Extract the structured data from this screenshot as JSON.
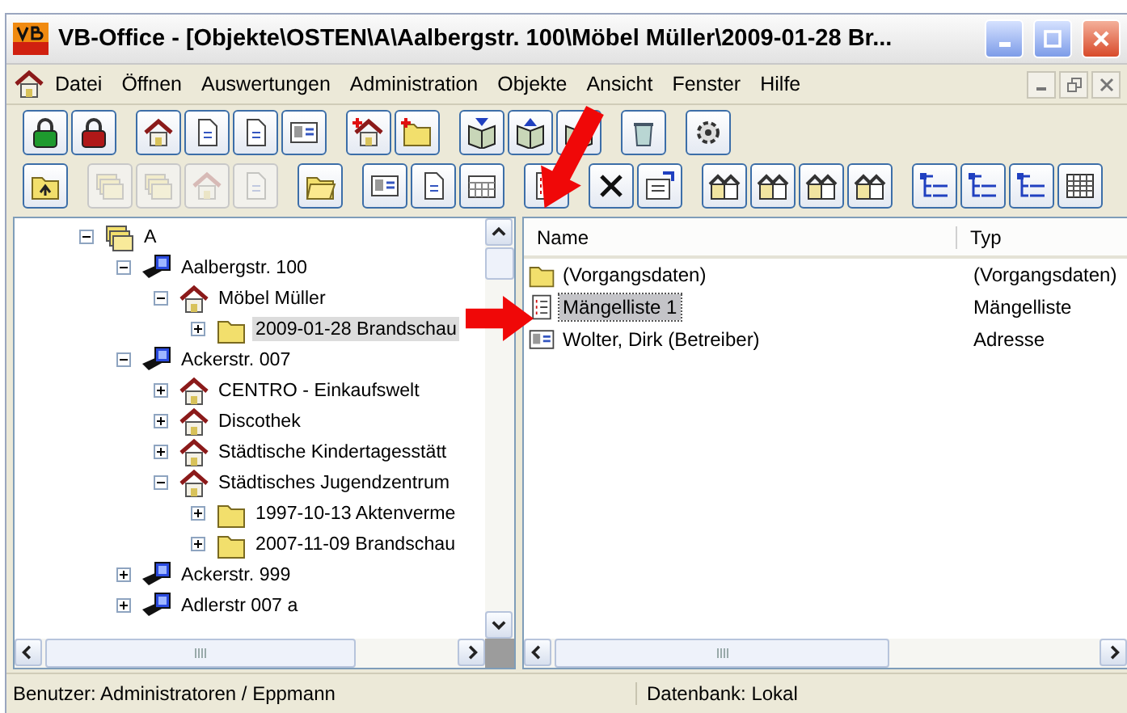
{
  "window": {
    "title": "VB-Office - [Objekte\\OSTEN\\A\\Aalbergstr. 100\\Möbel Müller\\2009-01-28 Br..."
  },
  "menu": [
    "Datei",
    "Öffnen",
    "Auswertungen",
    "Administration",
    "Objekte",
    "Ansicht",
    "Fenster",
    "Hilfe"
  ],
  "toolbars": [
    {
      "groups": [
        [
          {
            "kind": "lock-open",
            "disabled": false
          },
          {
            "kind": "lock-closed",
            "disabled": false
          }
        ],
        [
          {
            "kind": "house",
            "disabled": false
          },
          {
            "kind": "doc",
            "disabled": false
          },
          {
            "kind": "doc",
            "disabled": false
          },
          {
            "kind": "card",
            "disabled": false
          }
        ],
        [
          {
            "kind": "house-new",
            "disabled": false
          },
          {
            "kind": "folder-new",
            "disabled": false
          }
        ],
        [
          {
            "kind": "book-down",
            "disabled": false
          },
          {
            "kind": "book-up",
            "disabled": false
          },
          {
            "kind": "book",
            "disabled": false
          }
        ],
        [
          {
            "kind": "recycle",
            "disabled": false
          }
        ],
        [
          {
            "kind": "gear",
            "disabled": false
          }
        ]
      ]
    },
    {
      "groups": [
        [
          {
            "kind": "folder-up",
            "disabled": false
          }
        ],
        [
          {
            "kind": "stack",
            "disabled": true
          },
          {
            "kind": "stack",
            "disabled": true
          },
          {
            "kind": "house",
            "disabled": true
          },
          {
            "kind": "doc",
            "disabled": true
          }
        ],
        [
          {
            "kind": "folder-open",
            "disabled": false
          }
        ],
        [
          {
            "kind": "card",
            "disabled": false
          },
          {
            "kind": "doc",
            "disabled": false
          },
          {
            "kind": "calendar",
            "disabled": false
          }
        ],
        [
          {
            "kind": "list",
            "disabled": false
          }
        ],
        [
          {
            "kind": "delete",
            "disabled": false
          },
          {
            "kind": "properties",
            "disabled": false
          }
        ],
        [
          {
            "kind": "houses",
            "disabled": false
          },
          {
            "kind": "houses",
            "disabled": false
          },
          {
            "kind": "houses",
            "disabled": false
          },
          {
            "kind": "houses",
            "disabled": false
          }
        ],
        [
          {
            "kind": "tree",
            "disabled": false
          },
          {
            "kind": "tree",
            "disabled": false
          },
          {
            "kind": "tree",
            "disabled": false
          },
          {
            "kind": "grid",
            "disabled": false
          }
        ]
      ]
    }
  ],
  "tree": [
    {
      "label": "A",
      "kind": "group",
      "expanded": true,
      "selected": false,
      "children": [
        {
          "label": "Aalbergstr. 100",
          "kind": "street",
          "expanded": true,
          "selected": false,
          "children": [
            {
              "label": "Möbel Müller",
              "kind": "house",
              "expanded": true,
              "selected": false,
              "children": [
                {
                  "label": "2009-01-28 Brandschau",
                  "kind": "folder",
                  "expanded": false,
                  "selected": true
                }
              ]
            }
          ]
        },
        {
          "label": "Ackerstr. 007",
          "kind": "street",
          "expanded": true,
          "selected": false,
          "children": [
            {
              "label": "CENTRO - Einkaufswelt",
              "kind": "house",
              "expanded": false,
              "selected": false
            },
            {
              "label": "Discothek",
              "kind": "house",
              "expanded": false,
              "selected": false
            },
            {
              "label": "Städtische Kindertagesstätt",
              "kind": "house",
              "expanded": false,
              "selected": false
            },
            {
              "label": "Städtisches Jugendzentrum",
              "kind": "house",
              "expanded": true,
              "selected": false,
              "children": [
                {
                  "label": "1997-10-13 Aktenverme",
                  "kind": "folder",
                  "expanded": false,
                  "selected": false
                },
                {
                  "label": "2007-11-09 Brandschau",
                  "kind": "folder",
                  "expanded": false,
                  "selected": false
                }
              ]
            }
          ]
        },
        {
          "label": "Ackerstr. 999",
          "kind": "street",
          "expanded": false,
          "selected": false
        },
        {
          "label": "Adlerstr 007 a",
          "kind": "street",
          "expanded": false,
          "selected": false
        }
      ]
    }
  ],
  "list": {
    "columns": [
      "Name",
      "Typ"
    ],
    "rows": [
      {
        "name": "(Vorgangsdaten)",
        "type": "(Vorgangsdaten)",
        "kind": "folder",
        "selected": false
      },
      {
        "name": "Mängelliste 1",
        "type": "Mängelliste",
        "kind": "list",
        "selected": true
      },
      {
        "name": "Wolter, Dirk (Betreiber)",
        "type": "Adresse",
        "kind": "card",
        "selected": false
      }
    ]
  },
  "status_bar": [
    "Benutzer: Administratoren / Eppmann",
    "Datenbank: Lokal"
  ]
}
